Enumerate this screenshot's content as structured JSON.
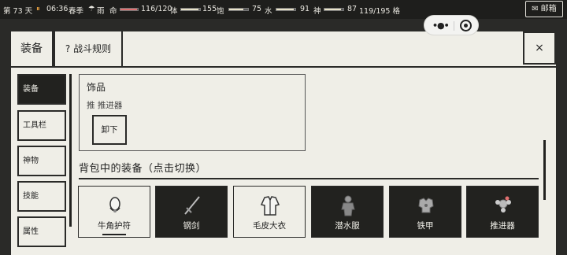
{
  "status": {
    "day": "第 73 天",
    "time": "06:36",
    "season": "春季",
    "weather": "雨",
    "hp_label": "命",
    "hp_value": "116/120",
    "stamina_label": "体",
    "stamina_value": "155",
    "hunger_label": "饱",
    "hunger_value": "75",
    "water_label": "水",
    "water_value": "91",
    "spirit_label": "神",
    "spirit_value": "87",
    "bag_value": "119/195 格",
    "hp_ratio": 0.967,
    "stamina_ratio": 0.9,
    "hunger_ratio": 0.75,
    "water_ratio": 0.91,
    "spirit_ratio": 0.87,
    "colors": {
      "hp": "#e07070",
      "stamina": "#e8e2c8",
      "hunger": "#e8e2c8",
      "water": "#e8e2c8",
      "spirit": "#e8e2c8"
    }
  },
  "mail_label": "✉ 邮箱",
  "header": {
    "tab_equip": "装备",
    "tab_rules": "? 战斗规则",
    "close": "×"
  },
  "nav": [
    "装备",
    "工具栏",
    "神物",
    "技能",
    "属性"
  ],
  "accessory": {
    "title": "饰品",
    "equipped": "推 推进器",
    "unequip": "卸下"
  },
  "backpack_title": "背包中的装备（点击切换）",
  "items": [
    {
      "name": "牛角护符",
      "icon": "horn-amulet-icon",
      "style": "light",
      "selected": true
    },
    {
      "name": "钢剑",
      "icon": "steel-sword-icon",
      "style": "dark",
      "selected": false
    },
    {
      "name": "毛皮大衣",
      "icon": "fur-coat-icon",
      "style": "light",
      "selected": false
    },
    {
      "name": "潜水服",
      "icon": "diving-suit-icon",
      "style": "dark",
      "selected": false
    },
    {
      "name": "铁甲",
      "icon": "iron-armor-icon",
      "style": "dark",
      "selected": false
    },
    {
      "name": "推进器",
      "icon": "thruster-icon",
      "style": "dark",
      "selected": false
    }
  ]
}
